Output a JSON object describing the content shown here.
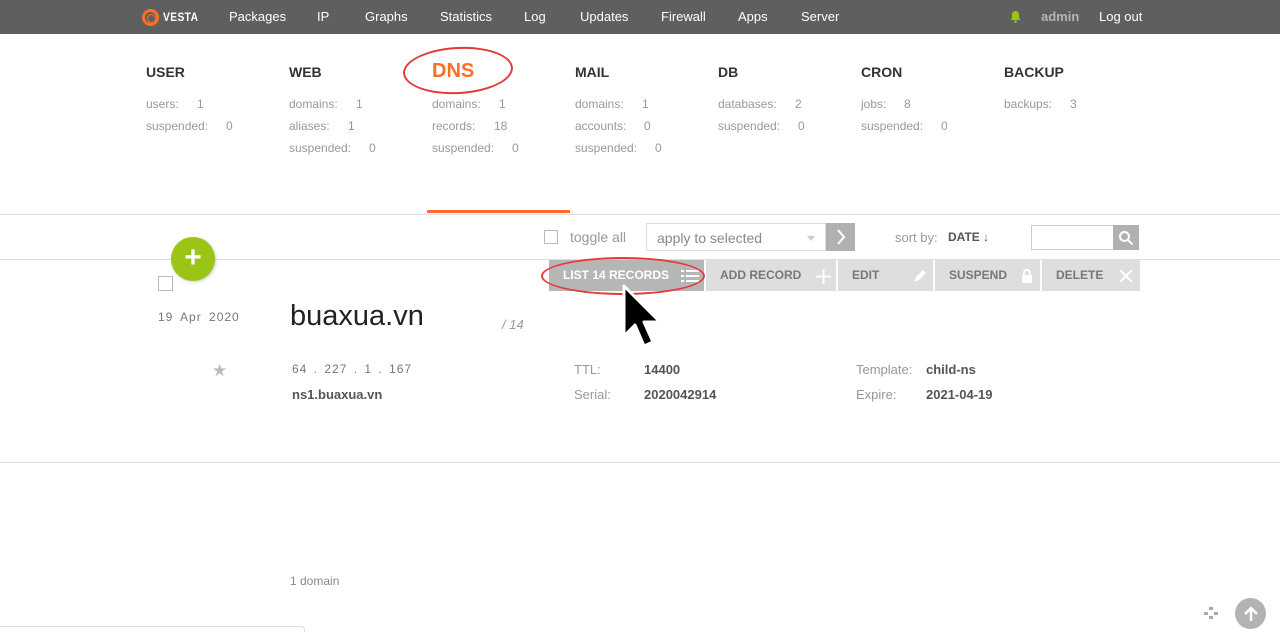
{
  "topnav": {
    "logo": "VESTA",
    "items": [
      "Packages",
      "IP",
      "Graphs",
      "Statistics",
      "Log",
      "Updates",
      "Firewall",
      "Apps",
      "Server"
    ],
    "user": "admin",
    "logout": "Log out"
  },
  "stats": {
    "user": {
      "title": "USER",
      "rows": [
        [
          "users:",
          "1"
        ],
        [
          "suspended:",
          "0"
        ]
      ]
    },
    "web": {
      "title": "WEB",
      "rows": [
        [
          "domains:",
          "1"
        ],
        [
          "aliases:",
          "1"
        ],
        [
          "suspended:",
          "0"
        ]
      ]
    },
    "dns": {
      "title": "DNS",
      "rows": [
        [
          "domains:",
          "1"
        ],
        [
          "records:",
          "18"
        ],
        [
          "suspended:",
          "0"
        ]
      ]
    },
    "mail": {
      "title": "MAIL",
      "rows": [
        [
          "domains:",
          "1"
        ],
        [
          "accounts:",
          "0"
        ],
        [
          "suspended:",
          "0"
        ]
      ]
    },
    "db": {
      "title": "DB",
      "rows": [
        [
          "databases:",
          "2"
        ],
        [
          "suspended:",
          "0"
        ]
      ]
    },
    "cron": {
      "title": "CRON",
      "rows": [
        [
          "jobs:",
          "8"
        ],
        [
          "suspended:",
          "0"
        ]
      ]
    },
    "backup": {
      "title": "BACKUP",
      "rows": [
        [
          "backups:",
          "3"
        ]
      ]
    }
  },
  "toolbar": {
    "toggle_all": "toggle all",
    "apply_select": "apply to selected",
    "sort_by_label": "sort by:",
    "sort_by_value": "DATE ↓",
    "search_placeholder": ""
  },
  "actions": {
    "list": "LIST 14 RECORDS",
    "add": "ADD RECORD",
    "edit": "EDIT",
    "suspend": "SUSPEND",
    "delete": "DELETE"
  },
  "domain_row": {
    "date": "19 Apr 2020",
    "domain": "buaxua.vn",
    "records_count": "/ 14",
    "ip": "64 . 227 . 1 . 167",
    "ns": "ns1.buaxua.vn",
    "ttl_label": "TTL:",
    "ttl": "14400",
    "serial_label": "Serial:",
    "serial": "2020042914",
    "template_label": "Template:",
    "template": "child-ns",
    "expire_label": "Expire:",
    "expire": "2021-04-19"
  },
  "footer": {
    "count": "1 domain"
  },
  "colors": {
    "accent": "#ff6e26",
    "add_button": "#9ac517",
    "nav_bg": "#5f5f5f",
    "annotation": "#e53a3a"
  }
}
